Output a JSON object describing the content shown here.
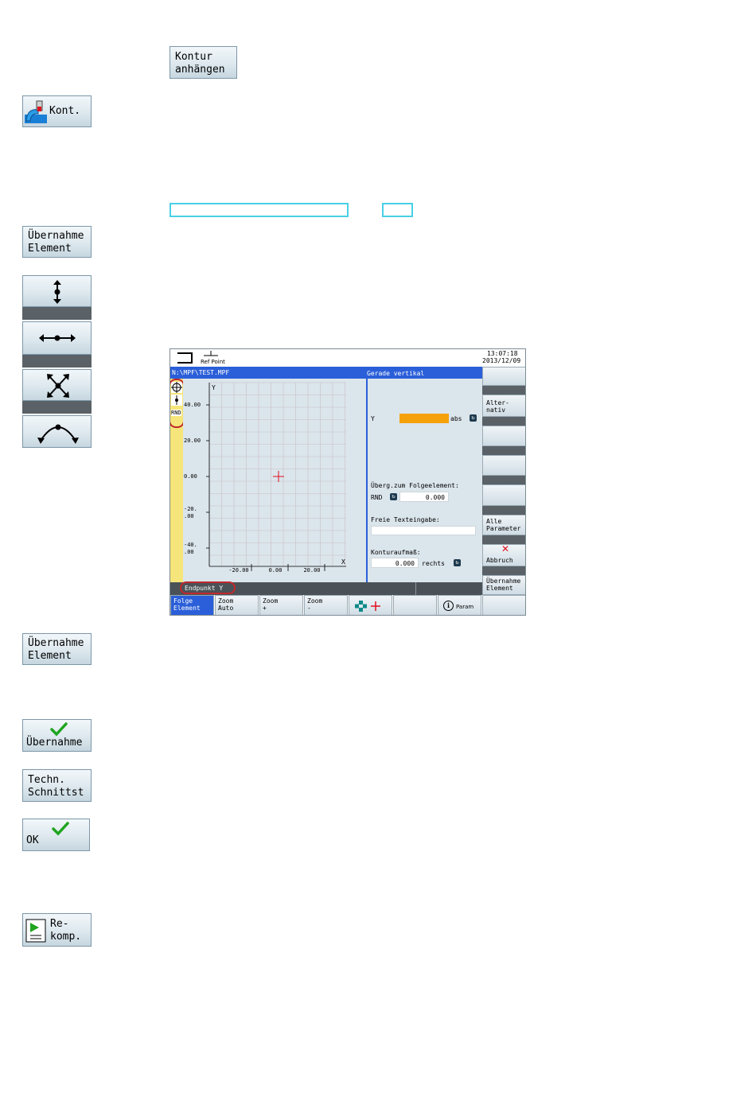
{
  "softkeys": {
    "kontur_anhaengen": "Kontur\nanhängen",
    "kont": "Kont.",
    "uebernahme_element_1": "Übernahme\nElement",
    "uebernahme_element_2": "Übernahme\nElement",
    "uebernahme": "Übernahme",
    "techn_schnittst": "Techn.\nSchnittst",
    "ok": "OK",
    "rekomp": "Re-\nkomp."
  },
  "screen": {
    "ref_point": "Ref Point",
    "clock_time": "13:07:18",
    "clock_date": "2013/12/09",
    "program_path": "N:\\MPF\\TEST.MPF",
    "element_title": "Gerade vertikal",
    "tool_label_rnd": "RND",
    "graphic": {
      "axis_y": "Y",
      "axis_x": "X",
      "y_ticks": [
        "40.00",
        "20.00",
        "0.00",
        "-20.\n.00",
        "-40.\n.00"
      ],
      "x_ticks": [
        "-20.00",
        "0.00",
        "20.00"
      ]
    },
    "form": {
      "y_label": "Y",
      "y_mode": "abs",
      "transition_label": "Überg.zum Folgeelement:",
      "transition_type": "RND",
      "transition_value": "0.000",
      "free_text_label": "Freie Texteingabe:",
      "free_text_value": "",
      "allowance_label": "Konturaufmaß:",
      "allowance_value": "0.000",
      "allowance_side": "rechts"
    },
    "status_hint": "Endpunkt Y",
    "vertical_softkeys": [
      "Alter-\nnativ",
      "Alle\nParameter",
      "Abbruch",
      "Übernahme\nElement"
    ],
    "horizontal_softkeys": [
      "Folge\nElement",
      "Zoom\nAuto",
      "Zoom\n+",
      "Zoom\n-",
      "",
      "",
      "Param",
      ""
    ]
  },
  "colors": {
    "title_bar": "#2b5fd9",
    "input_active": "#f5a10c",
    "left_strip": "#f6e57a",
    "highlight": "#48d0e6",
    "abort_x": "#e0101e",
    "check": "#1fa51f"
  }
}
